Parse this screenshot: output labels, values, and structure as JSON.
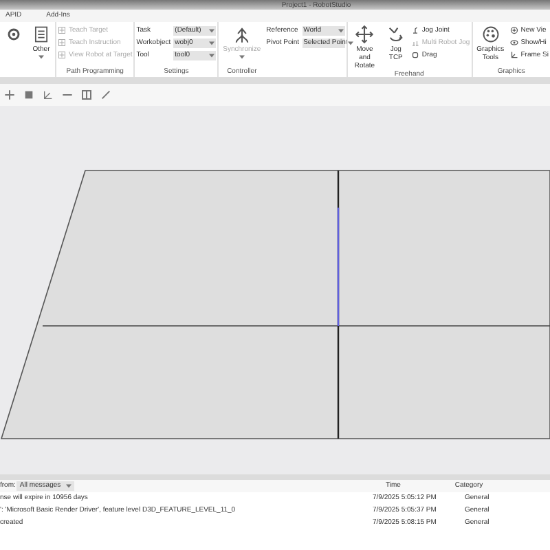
{
  "window": {
    "title": "Project1 - RobotStudio"
  },
  "tabs": [
    {
      "label": "APID",
      "selected": false
    },
    {
      "label": "Add-Ins",
      "selected": false
    }
  ],
  "ribbon": {
    "groups": [
      {
        "items": [
          {
            "kind": "big"
          }
        ]
      },
      {
        "items": [
          {
            "kind": "big",
            "label": "Other"
          }
        ]
      },
      {
        "label": "Path Programming",
        "items": [
          {
            "kind": "small",
            "label": "Teach Target",
            "disabled": true
          },
          {
            "kind": "small",
            "label": "Teach Instruction",
            "disabled": true
          },
          {
            "kind": "small",
            "label": "View Robot at Target",
            "disabled": true
          }
        ]
      },
      {
        "label": "Settings",
        "items": [
          {
            "kind": "combo",
            "label": "Task",
            "value": "(Default)"
          },
          {
            "kind": "combo",
            "label": "Workobject",
            "value": "wobj0"
          },
          {
            "kind": "combo",
            "label": "Tool",
            "value": "tool0"
          }
        ]
      },
      {
        "label": "Controller",
        "items": [
          {
            "kind": "big",
            "label": "Synchronize",
            "disabled": true
          }
        ]
      },
      {
        "items": [
          {
            "kind": "combo",
            "label": "Reference",
            "value": "World"
          },
          {
            "kind": "combo",
            "label": "Pivot Point",
            "value": "Selected Point"
          }
        ]
      },
      {
        "label": "Freehand",
        "items": [
          {
            "kind": "big",
            "label": "Move and Rotate"
          },
          {
            "kind": "big",
            "label": "Jog TCP"
          },
          {
            "kind": "small",
            "label": "Jog Joint",
            "disabled": false
          },
          {
            "kind": "small",
            "label": "Multi Robot Jog",
            "disabled": true
          },
          {
            "kind": "small",
            "label": "Drag",
            "disabled": false
          }
        ]
      },
      {
        "label": "Graphics",
        "items": [
          {
            "kind": "big",
            "label": "Graphics Tools"
          },
          {
            "kind": "small",
            "label": "New Vie"
          },
          {
            "kind": "small",
            "label": "Show/Hi"
          },
          {
            "kind": "small",
            "label": "Frame Si"
          }
        ]
      }
    ]
  },
  "output": {
    "filter_label": "from:",
    "filter_value": "All messages",
    "columns": [
      "Time",
      "Category"
    ],
    "rows": [
      {
        "message": "nse will expire in 10956 days",
        "time": "7/9/2025 5:05:12 PM",
        "category": "General"
      },
      {
        "message": "': 'Microsoft Basic Render Driver', feature level D3D_FEATURE_LEVEL_11_0",
        "time": "7/9/2025 5:05:37 PM",
        "category": "General"
      },
      {
        "message": "created",
        "time": "7/9/2025 5:08:15 PM",
        "category": "General"
      }
    ]
  }
}
